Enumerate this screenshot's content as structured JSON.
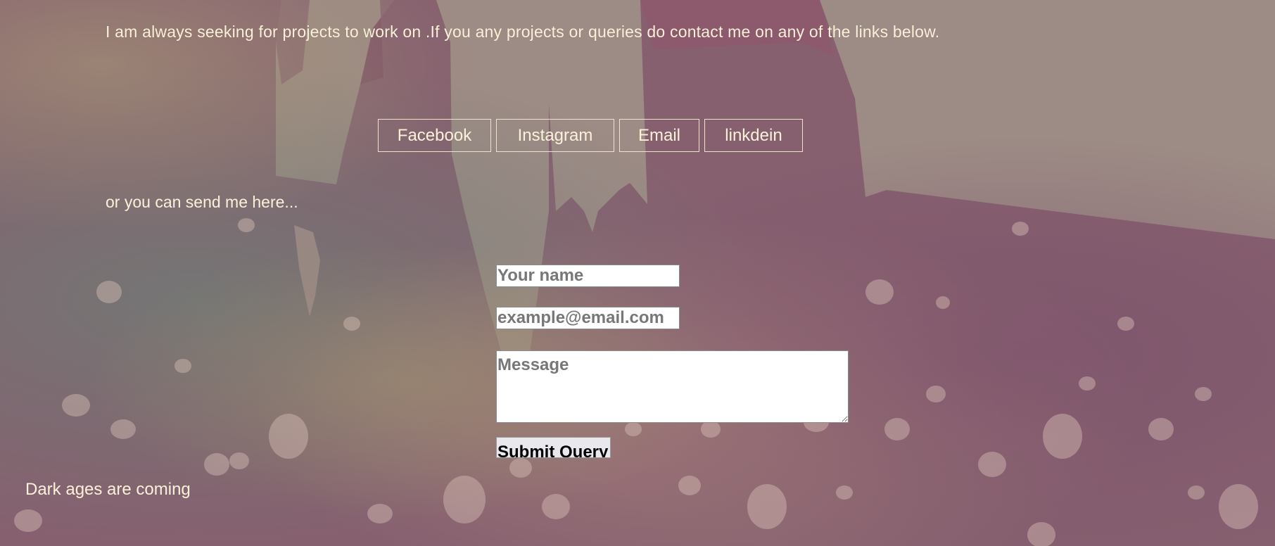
{
  "intro": {
    "text": "I am always seeking for projects to work on .If you any projects or queries do contact me on any of the links below."
  },
  "links": [
    {
      "label": "Facebook"
    },
    {
      "label": "Instagram"
    },
    {
      "label": "Email"
    },
    {
      "label": "linkdein"
    }
  ],
  "form": {
    "intro_text": "or you can send me here...",
    "name_placeholder": "Your name",
    "email_placeholder": "example@email.com",
    "message_placeholder": "Message",
    "submit_label": "Submit Query"
  },
  "footer": {
    "text": "Dark ages are coming"
  },
  "colors": {
    "text": "#fbf1d9",
    "sky": "#9e8d85",
    "castle": "#8a5a70"
  }
}
